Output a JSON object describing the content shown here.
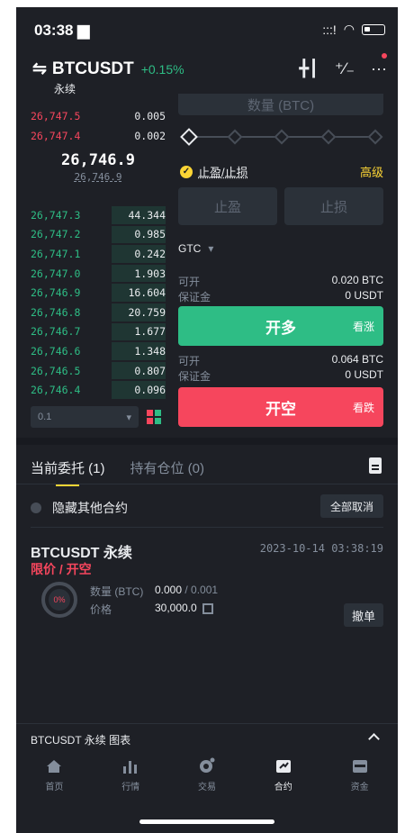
{
  "status": {
    "time": "03:38",
    "signal": ":::!",
    "wifi": "wifi"
  },
  "header": {
    "symbol": "BTCUSDT",
    "change": "+0.15%",
    "subtitle": "永续",
    "icons": [
      "candlestick-icon",
      "percent-toggle-icon",
      "more-icon"
    ]
  },
  "orderbook": {
    "asks": [
      {
        "price": "26,747.5",
        "qty": "0.005"
      },
      {
        "price": "26,747.4",
        "qty": "0.002"
      }
    ],
    "last_price": "26,746.9",
    "mark_price": "26,746.9",
    "bids": [
      {
        "price": "26,747.3",
        "qty": "44.344",
        "depth": 0.4
      },
      {
        "price": "26,747.2",
        "qty": "0.985",
        "depth": 0.4
      },
      {
        "price": "26,747.1",
        "qty": "0.242",
        "depth": 0.4
      },
      {
        "price": "26,747.0",
        "qty": "1.903",
        "depth": 0.4
      },
      {
        "price": "26,746.9",
        "qty": "16.604",
        "depth": 0.4
      },
      {
        "price": "26,746.8",
        "qty": "20.759",
        "depth": 0.4
      },
      {
        "price": "26,746.7",
        "qty": "1.677",
        "depth": 0.4
      },
      {
        "price": "26,746.6",
        "qty": "1.348",
        "depth": 0.4
      },
      {
        "price": "26,746.5",
        "qty": "0.807",
        "depth": 0.4
      },
      {
        "price": "26,746.4",
        "qty": "0.096",
        "depth": 0.4
      }
    ],
    "depth_select": "0.1"
  },
  "form": {
    "qty_placeholder": "数量 (BTC)",
    "qty_stepper": "+",
    "tpsl_label": "止盈/止损",
    "advanced": "高级",
    "tp_placeholder": "止盈",
    "sl_placeholder": "止损",
    "tif": "GTC",
    "long": {
      "avail_label": "可开",
      "avail_value": "0.020 BTC",
      "margin_label": "保证金",
      "margin_value": "0 USDT",
      "button": "开多",
      "button_sub": "看涨"
    },
    "short": {
      "avail_label": "可开",
      "avail_value": "0.064 BTC",
      "margin_label": "保证金",
      "margin_value": "0 USDT",
      "button": "开空",
      "button_sub": "看跌"
    }
  },
  "tabs": {
    "open_orders": "当前委托 (1)",
    "positions": "持有仓位 (0)"
  },
  "filters": {
    "hide_other": "隐藏其他合约",
    "cancel_all": "全部取消"
  },
  "order": {
    "title": "BTCUSDT 永续",
    "time": "2023-10-14 03:38:19",
    "type": "限价 / 开空",
    "filled_pct": "0%",
    "qty_label": "数量 (BTC)",
    "qty_filled": "0.000",
    "qty_total": "/ 0.001",
    "price_label": "价格",
    "price_value": "30,000.0",
    "cancel": "撤单"
  },
  "chart_bar": {
    "label": "BTCUSDT 永续  图表"
  },
  "nav": [
    {
      "label": "首页",
      "icon": "home-icon",
      "active": false
    },
    {
      "label": "行情",
      "icon": "markets-icon",
      "active": false
    },
    {
      "label": "交易",
      "icon": "trade-icon",
      "active": false
    },
    {
      "label": "合约",
      "icon": "futures-icon",
      "active": true
    },
    {
      "label": "资金",
      "icon": "wallet-icon",
      "active": false
    }
  ],
  "colors": {
    "bg": "#1e2026",
    "green": "#2ebd85",
    "red": "#f6465d",
    "yellow": "#fcd535",
    "muted": "#848e9c"
  }
}
